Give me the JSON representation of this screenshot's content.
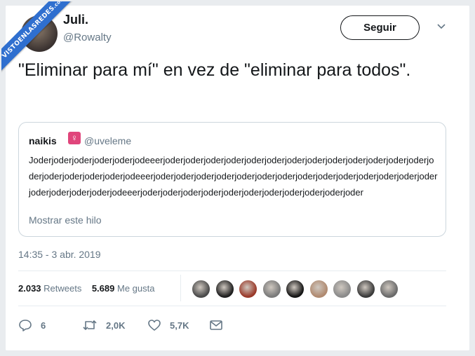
{
  "watermark": {
    "text": "VISTOENLASREDES",
    "sub": ".com"
  },
  "tweet": {
    "name": "Juli.",
    "handle": "@Rowalty",
    "follow_label": "Seguir",
    "text": "\"Eliminar para mí\" en vez de \"eliminar para todos\".",
    "timestamp": "14:35 - 3 abr. 2019"
  },
  "quoted": {
    "name": "naikis",
    "emoji": "♀",
    "handle": "@uveleme",
    "body": "Joderjoderjoderjoderjoderjodeeerjoderjoderjoderjoderjoderjoderjoderjoderjoderjoderjoderjoderjoderjoderjoderjoderjoderjoderjodeeerjoderjoderjoderjoderjoderjoderjoderjoderjoderjoderjoderjoderjoderjoderjoderjoderjoderjoderjodeeerjoderjoderjoderjoderjoderjoderjoderjoderjoderjoderjoder",
    "more_label": "Mostrar este hilo"
  },
  "stats": {
    "retweets_count": "2.033",
    "retweets_label": "Retweets",
    "likes_count": "5.689",
    "likes_label": "Me gusta"
  },
  "likers": [
    {
      "color": "#4a4a4a"
    },
    {
      "color": "#1f1f1f"
    },
    {
      "color": "#9a3a2a"
    },
    {
      "color": "#7a7a7a"
    },
    {
      "color": "#151515"
    },
    {
      "color": "#b08a70"
    },
    {
      "color": "#8a8a8a"
    },
    {
      "color": "#3a3a3a"
    },
    {
      "color": "#6a6a6a"
    }
  ],
  "actions": {
    "replies": "6",
    "retweets": "2,0K",
    "likes": "5,7K"
  },
  "icons": {
    "reply": "reply-icon",
    "retweet": "retweet-icon",
    "like": "heart-icon",
    "dm": "envelope-icon",
    "caret": "chevron-down-icon"
  }
}
